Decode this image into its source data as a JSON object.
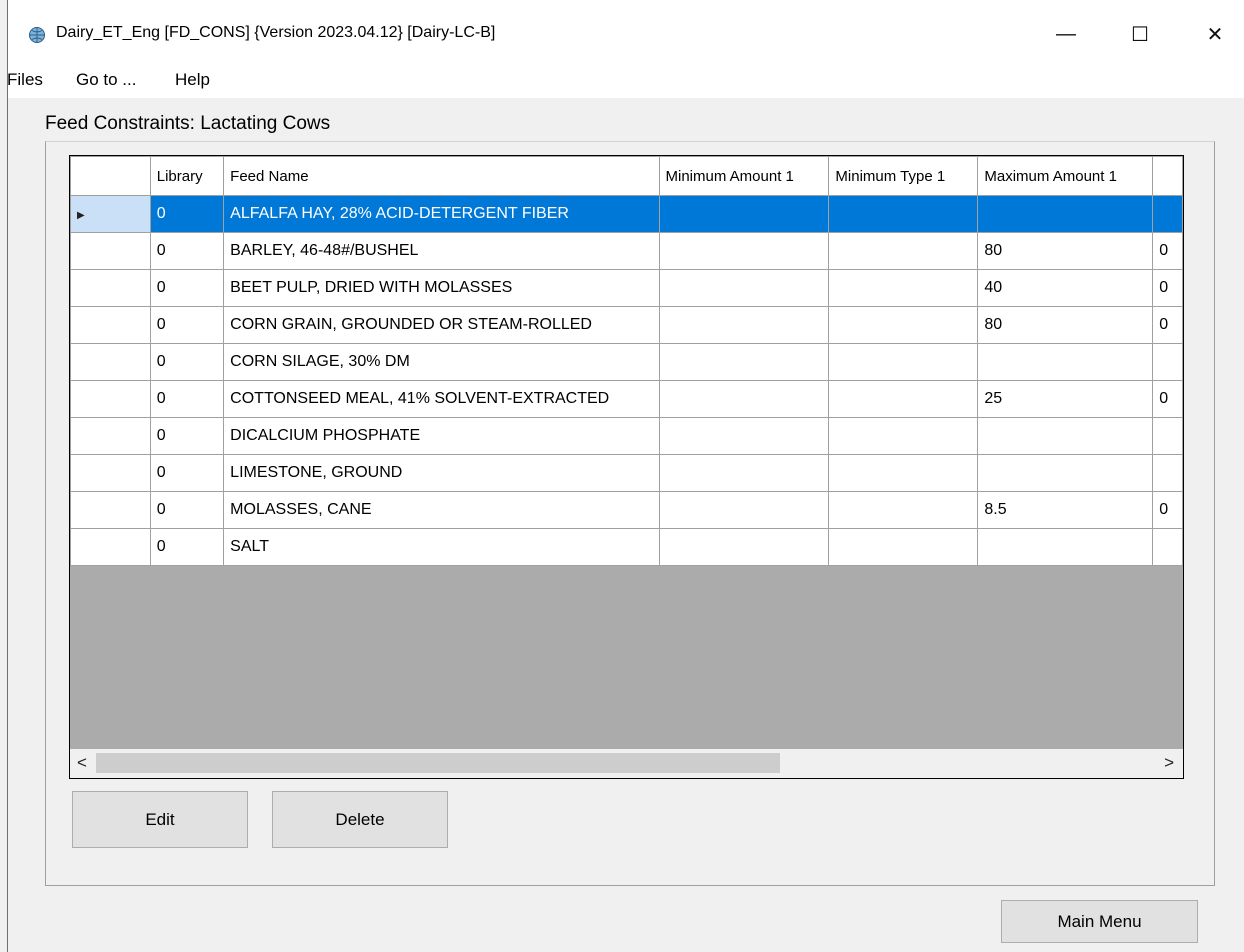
{
  "window": {
    "title": "Dairy_ET_Eng [FD_CONS] {Version 2023.04.12}  [Dairy-LC-B]",
    "minimize_glyph": "—",
    "maximize_glyph": "☐",
    "close_glyph": "✕"
  },
  "menu": {
    "files": "Files",
    "goto": "Go to ...",
    "help": "Help"
  },
  "section_label": "Feed Constraints: Lactating Cows",
  "grid": {
    "columns": [
      "Library",
      "Feed Name",
      "Minimum Amount 1",
      "Minimum Type 1",
      "Maximum Amount 1",
      ""
    ],
    "rows": [
      {
        "library": "0",
        "feed": "ALFALFA HAY, 28% ACID-DETERGENT FIBER",
        "min_amt": "",
        "min_type": "",
        "max_amt": "",
        "extra": "",
        "selected": true
      },
      {
        "library": "0",
        "feed": "BARLEY, 46-48#/BUSHEL",
        "min_amt": "",
        "min_type": "",
        "max_amt": "80",
        "extra": "0"
      },
      {
        "library": "0",
        "feed": "BEET PULP, DRIED WITH MOLASSES",
        "min_amt": "",
        "min_type": "",
        "max_amt": "40",
        "extra": "0"
      },
      {
        "library": "0",
        "feed": "CORN GRAIN, GROUNDED OR STEAM-ROLLED",
        "min_amt": "",
        "min_type": "",
        "max_amt": "80",
        "extra": "0"
      },
      {
        "library": "0",
        "feed": "CORN SILAGE, 30% DM",
        "min_amt": "",
        "min_type": "",
        "max_amt": "",
        "extra": ""
      },
      {
        "library": "0",
        "feed": "COTTONSEED MEAL, 41% SOLVENT-EXTRACTED",
        "min_amt": "",
        "min_type": "",
        "max_amt": "25",
        "extra": "0"
      },
      {
        "library": "0",
        "feed": "DICALCIUM PHOSPHATE",
        "min_amt": "",
        "min_type": "",
        "max_amt": "",
        "extra": ""
      },
      {
        "library": "0",
        "feed": "LIMESTONE, GROUND",
        "min_amt": "",
        "min_type": "",
        "max_amt": "",
        "extra": ""
      },
      {
        "library": "0",
        "feed": "MOLASSES, CANE",
        "min_amt": "",
        "min_type": "",
        "max_amt": "8.5",
        "extra": "0"
      },
      {
        "library": "0",
        "feed": "SALT",
        "min_amt": "",
        "min_type": "",
        "max_amt": "",
        "extra": ""
      }
    ],
    "row_header_arrow": "▶",
    "scroll_left": "<",
    "scroll_right": ">"
  },
  "buttons": {
    "edit": "Edit",
    "delete": "Delete",
    "main_menu": "Main Menu"
  },
  "colors": {
    "selection": "#0078d7",
    "grid_empty": "#ababab"
  }
}
